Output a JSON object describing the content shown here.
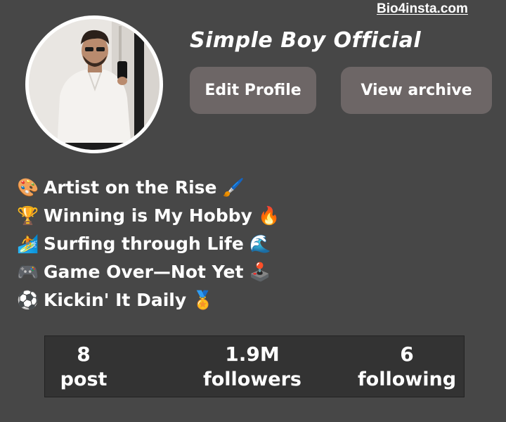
{
  "watermark": "Bio4insta.com",
  "profile": {
    "username": "Simple Boy Official",
    "avatar_icon": "profile-photo"
  },
  "actions": {
    "edit_label": "Edit Profile",
    "archive_label": "View archive"
  },
  "bio": [
    {
      "lead": "🎨",
      "text": "Artist on the Rise",
      "tail": "🖌️"
    },
    {
      "lead": "🏆",
      "text": "Winning is My Hobby",
      "tail": "🔥"
    },
    {
      "lead": "🏄",
      "text": "Surfing through Life",
      "tail": "🌊"
    },
    {
      "lead": "🎮",
      "text": "Game Over—Not Yet",
      "tail": "🕹️"
    },
    {
      "lead": "⚽",
      "text": "Kickin' It Daily",
      "tail": "🏅"
    }
  ],
  "stats": {
    "post": {
      "value": "8",
      "label": "post"
    },
    "followers": {
      "value": "1.9M",
      "label": "followers"
    },
    "following": {
      "value": "6",
      "label": "following"
    }
  },
  "colors": {
    "background": "#474747",
    "button": "#6d6666",
    "stats_box": "#333333"
  }
}
